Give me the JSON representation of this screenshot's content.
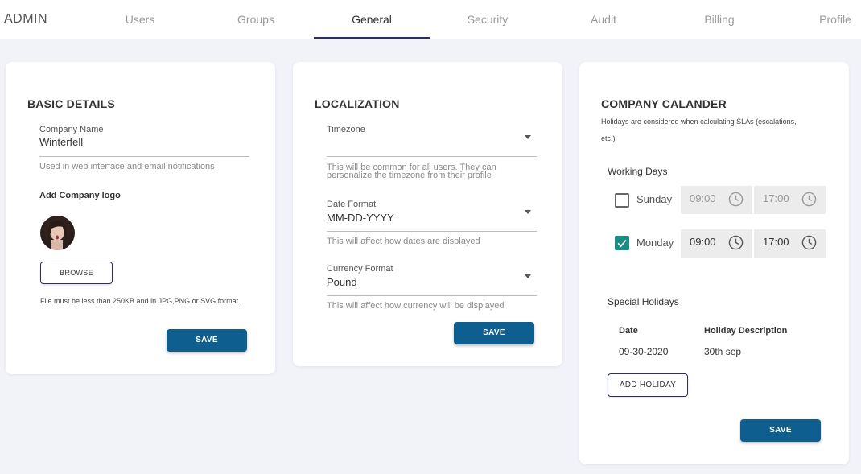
{
  "header": {
    "brand": "ADMIN",
    "tabs": [
      {
        "label": "Users"
      },
      {
        "label": "Groups"
      },
      {
        "label": "General"
      },
      {
        "label": "Security"
      },
      {
        "label": "Audit"
      },
      {
        "label": "Billing"
      },
      {
        "label": "Profile"
      }
    ],
    "active_tab": "General"
  },
  "basic_details": {
    "title": "BASIC DETAILS",
    "company_name_label": "Company Name",
    "company_name_value": "Winterfell",
    "company_name_hint": "Used in web interface and email notifications",
    "logo_label": "Add Company logo",
    "browse_label": "BROWSE",
    "file_hint": "File must be less than 250KB and in JPG,PNG or SVG format.",
    "save_label": "SAVE"
  },
  "localization": {
    "title": "LOCALIZATION",
    "timezone_label": "Timezone",
    "timezone_value": "",
    "timezone_hint_1": "This will be common for all users. They can",
    "timezone_hint_2": "personalize the timezone from their profile",
    "date_format_label": "Date Format",
    "date_format_value": "MM-DD-YYYY",
    "date_format_hint": "This will affect how dates are displayed",
    "currency_label": "Currency Format",
    "currency_value": "Pound",
    "currency_hint": "This will affect how currency will be displayed",
    "save_label": "SAVE"
  },
  "company_calendar": {
    "title": "COMPANY CALANDER",
    "subtitle_1": "Holidays are considered when calculating SLAs (escalations,",
    "subtitle_2": "etc.)",
    "working_days_title": "Working Days",
    "days": [
      {
        "name": "Sunday",
        "checked": false,
        "start": "09:00",
        "end": "17:00"
      },
      {
        "name": "Monday",
        "checked": true,
        "start": "09:00",
        "end": "17:00"
      }
    ],
    "special_holidays_title": "Special Holidays",
    "table_headers": {
      "date": "Date",
      "description": "Holiday Description"
    },
    "holidays": [
      {
        "date": "09-30-2020",
        "description": "30th sep"
      }
    ],
    "add_holiday_label": "ADD HOLIDAY",
    "save_label": "SAVE"
  },
  "colors": {
    "accent": "#2d2f5e",
    "primary_button": "#0e5f8f",
    "checkbox_checked": "#1b8d84",
    "page_background": "#f2f2f9"
  }
}
